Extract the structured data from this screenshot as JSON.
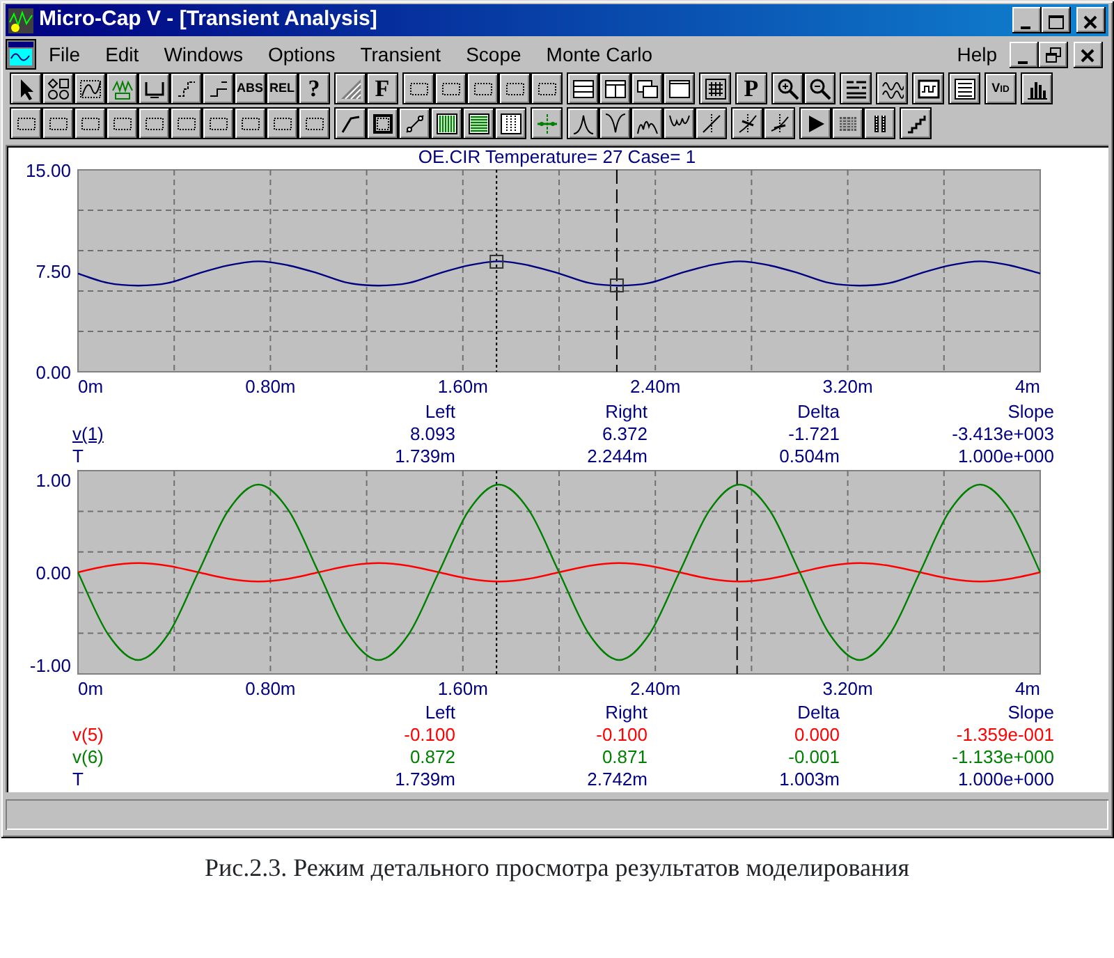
{
  "window": {
    "title": "Micro-Cap V - [Transient Analysis]"
  },
  "menu": [
    {
      "label": "File"
    },
    {
      "label": "Edit"
    },
    {
      "label": "Windows"
    },
    {
      "label": "Options"
    },
    {
      "label": "Transient"
    },
    {
      "label": "Scope"
    },
    {
      "label": "Monte Carlo"
    }
  ],
  "help_menu": {
    "label": "Help"
  },
  "toolbars": [
    {
      "groups": [
        {
          "buttons": [
            {
              "kind": "icon"
            },
            {
              "kind": "icon"
            },
            {
              "kind": "icon"
            },
            {
              "kind": "icon"
            },
            {
              "kind": "icon"
            },
            {
              "kind": "icon"
            },
            {
              "kind": "icon"
            },
            {
              "kind": "text",
              "label": "ABS"
            },
            {
              "kind": "text",
              "label": "REL"
            },
            {
              "kind": "text",
              "label": "?"
            }
          ]
        },
        {
          "buttons": [
            {
              "kind": "icon"
            },
            {
              "kind": "text",
              "label": "F"
            }
          ]
        },
        {
          "buttons": [
            {
              "kind": "icon"
            },
            {
              "kind": "icon"
            },
            {
              "kind": "icon"
            },
            {
              "kind": "icon"
            },
            {
              "kind": "icon"
            }
          ]
        },
        {
          "buttons": [
            {
              "kind": "icon"
            },
            {
              "kind": "icon"
            },
            {
              "kind": "icon"
            },
            {
              "kind": "icon"
            }
          ]
        },
        {
          "buttons": [
            {
              "kind": "icon"
            }
          ]
        },
        {
          "buttons": [
            {
              "kind": "text",
              "label": "P"
            }
          ]
        },
        {
          "buttons": [
            {
              "kind": "icon"
            },
            {
              "kind": "icon"
            }
          ]
        },
        {
          "buttons": [
            {
              "kind": "icon"
            }
          ]
        },
        {
          "buttons": [
            {
              "kind": "icon"
            }
          ]
        },
        {
          "buttons": [
            {
              "kind": "icon"
            }
          ]
        },
        {
          "buttons": [
            {
              "kind": "icon"
            }
          ]
        },
        {
          "buttons": [
            {
              "kind": "text",
              "label": "V$_{ID}$"
            }
          ]
        },
        {
          "buttons": [
            {
              "kind": "icon"
            }
          ]
        }
      ]
    },
    {
      "groups": [
        {
          "buttons": [
            {
              "kind": "icon"
            },
            {
              "kind": "icon"
            },
            {
              "kind": "icon"
            },
            {
              "kind": "icon"
            },
            {
              "kind": "icon"
            },
            {
              "kind": "icon"
            },
            {
              "kind": "icon"
            },
            {
              "kind": "icon"
            },
            {
              "kind": "icon"
            },
            {
              "kind": "icon"
            }
          ]
        },
        {
          "buttons": [
            {
              "kind": "icon"
            },
            {
              "kind": "icon"
            },
            {
              "kind": "icon"
            },
            {
              "kind": "icon"
            },
            {
              "kind": "icon"
            },
            {
              "kind": "icon"
            }
          ]
        },
        {
          "buttons": [
            {
              "kind": "icon"
            }
          ]
        },
        {
          "buttons": [
            {
              "kind": "icon"
            },
            {
              "kind": "icon"
            },
            {
              "kind": "icon"
            },
            {
              "kind": "icon"
            },
            {
              "kind": "icon"
            }
          ]
        },
        {
          "buttons": [
            {
              "kind": "icon"
            },
            {
              "kind": "icon"
            }
          ]
        },
        {
          "buttons": [
            {
              "kind": "icon"
            },
            {
              "kind": "icon"
            },
            {
              "kind": "icon"
            }
          ]
        },
        {
          "buttons": [
            {
              "kind": "icon"
            }
          ]
        }
      ]
    }
  ],
  "plot_title": "OE.CIR Temperature= 27 Case= 1",
  "plots": [
    {
      "chart_data": {
        "type": "line",
        "xlim": [
          0,
          4
        ],
        "ylim": [
          0,
          15
        ],
        "grid": true,
        "x": [
          0,
          0.125,
          0.25,
          0.375,
          0.5,
          0.625,
          0.75,
          0.875,
          1,
          1.125,
          1.25,
          1.375,
          1.5,
          1.625,
          1.75,
          1.875,
          2,
          2.125,
          2.25,
          2.375,
          2.5,
          2.625,
          2.75,
          2.875,
          3,
          3.125,
          3.25,
          3.375,
          3.5,
          3.625,
          3.75,
          3.875,
          4
        ],
        "xticks": [
          {
            "value": 0,
            "label": "0m"
          },
          {
            "value": 0.8,
            "label": "0.80m"
          },
          {
            "value": 1.6,
            "label": "1.60m"
          },
          {
            "value": 2.4,
            "label": "2.40m"
          },
          {
            "value": 3.2,
            "label": "3.20m"
          },
          {
            "value": 4,
            "label": "4m"
          }
        ],
        "yticks": [
          {
            "value": 15,
            "label": "15.00"
          },
          {
            "value": 7.5,
            "label": "7.50"
          },
          {
            "value": 0,
            "label": "0.00"
          }
        ],
        "series": [
          {
            "color": "#000080",
            "values": [
              7.3,
              6.6,
              6.4,
              6.6,
              7.3,
              7.9,
              8.2,
              7.9,
              7.3,
              6.6,
              6.4,
              6.6,
              7.3,
              7.9,
              8.2,
              7.9,
              7.3,
              6.6,
              6.4,
              6.6,
              7.3,
              7.9,
              8.2,
              7.9,
              7.3,
              6.6,
              6.4,
              6.6,
              7.3,
              7.9,
              8.2,
              7.9,
              7.3
            ]
          }
        ],
        "ref_lines": [
          {
            "axis": "x",
            "value": 1.74
          },
          {
            "axis": "x",
            "value": 2.24
          }
        ]
      },
      "table": {
        "columns": [
          "Left",
          "Right",
          "Delta",
          "Slope"
        ],
        "rows": [
          {
            "label": "v(1)",
            "underlined": true,
            "color": "#000080",
            "values": [
              "8.093",
              "6.372",
              "-1.721",
              "-3.413e+003"
            ]
          },
          {
            "label": "T",
            "underlined": false,
            "color": "#000080",
            "values": [
              "1.739m",
              "2.244m",
              "0.504m",
              "1.000e+000"
            ]
          }
        ]
      }
    },
    {
      "chart_data": {
        "type": "line",
        "xlim": [
          0,
          4
        ],
        "ylim": [
          -1.1,
          1.1
        ],
        "grid": true,
        "x": [
          0,
          0.125,
          0.25,
          0.375,
          0.5,
          0.625,
          0.75,
          0.875,
          1,
          1.125,
          1.25,
          1.375,
          1.5,
          1.625,
          1.75,
          1.875,
          2,
          2.125,
          2.25,
          2.375,
          2.5,
          2.625,
          2.75,
          2.875,
          3,
          3.125,
          3.25,
          3.375,
          3.5,
          3.625,
          3.75,
          3.875,
          4
        ],
        "xticks": [
          {
            "value": 0,
            "label": "0m"
          },
          {
            "value": 0.8,
            "label": "0.80m"
          },
          {
            "value": 1.6,
            "label": "1.60m"
          },
          {
            "value": 2.4,
            "label": "2.40m"
          },
          {
            "value": 3.2,
            "label": "3.20m"
          },
          {
            "value": 4,
            "label": "4m"
          }
        ],
        "yticks": [
          {
            "value": 1,
            "label": "1.00"
          },
          {
            "value": 0,
            "label": "0.00"
          },
          {
            "value": -1,
            "label": "-1.00"
          }
        ],
        "series": [
          {
            "color": "#ff0000",
            "values": [
              0,
              0.07,
              0.1,
              0.07,
              0,
              -0.07,
              -0.1,
              -0.07,
              0,
              0.07,
              0.1,
              0.07,
              0,
              -0.07,
              -0.1,
              -0.07,
              0,
              0.07,
              0.1,
              0.07,
              0,
              -0.07,
              -0.1,
              -0.07,
              0,
              0.07,
              0.1,
              0.07,
              0,
              -0.07,
              -0.1,
              -0.07,
              0
            ]
          },
          {
            "color": "#008000",
            "values": [
              0,
              -0.67,
              -0.95,
              -0.67,
              0,
              0.67,
              0.95,
              0.67,
              0,
              -0.67,
              -0.95,
              -0.67,
              0,
              0.67,
              0.95,
              0.67,
              0,
              -0.67,
              -0.95,
              -0.67,
              0,
              0.67,
              0.95,
              0.67,
              0,
              -0.67,
              -0.95,
              -0.67,
              0,
              0.67,
              0.95,
              0.67,
              0
            ]
          }
        ],
        "ref_lines": [
          {
            "axis": "x",
            "value": 1.74
          },
          {
            "axis": "x",
            "value": 2.74
          }
        ]
      },
      "table": {
        "columns": [
          "Left",
          "Right",
          "Delta",
          "Slope"
        ],
        "rows": [
          {
            "label": "v(5)",
            "underlined": false,
            "color": "#ff0000",
            "values": [
              "-0.100",
              "-0.100",
              "0.000",
              "-1.359e-001"
            ]
          },
          {
            "label": "v(6)",
            "underlined": false,
            "color": "#008000",
            "values": [
              "0.872",
              "0.871",
              "-0.001",
              "-1.133e+000"
            ]
          },
          {
            "label": "T",
            "underlined": false,
            "color": "#000080",
            "values": [
              "1.739m",
              "2.742m",
              "1.003m",
              "1.000e+000"
            ]
          }
        ]
      }
    }
  ],
  "caption": "Рис.2.3. Режим детального просмотра результатов моделирования"
}
